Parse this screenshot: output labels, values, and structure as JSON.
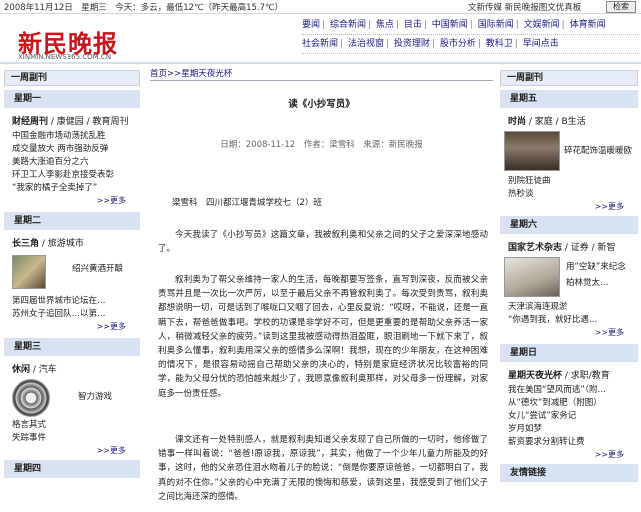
{
  "topbar": {
    "date": "2008年11月12日　星期三　今天：多云，最低12℃（昨天最高15.7℃）",
    "headlines": "文新传媒  新民晚报图文优真板",
    "search_label": "检索"
  },
  "logo": {
    "text": "新民晚报",
    "url": "XINMIN.NEWS365.COM.CN"
  },
  "nav": {
    "row1": [
      "要闻",
      "综合新闻",
      "焦点",
      "目击",
      "中国新闻",
      "国际新闻",
      "文娱新闻",
      "体育新闻"
    ],
    "row2": [
      "社会新闻",
      "法治视窗",
      "投资理财",
      "股市分析",
      "教科卫",
      "早间点击"
    ]
  },
  "left": {
    "title": "一周副刊",
    "sections": [
      {
        "head": "星期一",
        "sub_bold": "财经周刊",
        "sub_rest": " / 康健园 / 教育周刊",
        "items": [
          "中国金融市场动荡扰乱胜",
          "成交量放大 两市强劲反弹",
          "美路大涨逾百分之六",
          "环卫工人李影赴京接受表彰",
          "“我家的橘子全卖掉了”"
        ],
        "more": ">>更多"
      },
      {
        "head": "星期二",
        "sub_bold": "长三角",
        "sub_rest": " / 旅游城市",
        "items": [
          "绍兴黄酒开酿",
          "第四届世界城市论坛在…",
          "苏州女子追回队…以第…"
        ],
        "more": ">>更多"
      },
      {
        "head": "星期三",
        "sub_bold": "休闲",
        "sub_rest": " / 汽车",
        "items": [
          "智力游戏",
          "格言其式",
          "失踪事件"
        ],
        "more": ">>更多"
      },
      {
        "head": "星期四"
      }
    ]
  },
  "article": {
    "breadcrumb": "首页>>星期天夜光杯",
    "title": "读《小抄写员》",
    "meta": "日期：2008-11-12　作者：梁雪科　来源：新民晚报",
    "author_line": "梁雪科　四川都江堰青城学校七（2）班",
    "paragraphs": [
      "今天我读了《小抄写员》这篇文章，我被叙利奥和父亲之间的父子之爱深深地感动了。",
      "叙利奥为了帮父亲维持一家人的生活，每晚都要写签条，直写到深夜，反而被父亲责骂并且是一次比一次严厉，以至于最后父亲不再管叙利奥了。每次受到责骂，叙利奥都想说明一切，可是话到了喉咙口又咽了回去，心里反复说：“哎呀，不能说，还是一直瞒下去，帮爸爸做事吧。学校的功课是非学好不可，但是更重要的是帮助父亲养活一家人，稍微减轻父亲的疲劳。”读到这里我被感动得热泪盈眶，眼泪刷地一下就下来了，叙利奥多么懂事，叙利奥用深父亲的感情多么深啊！我想，现在的少年朋友，在这种困难的情况下，是很容易动摇自己帮助父亲的决心的，特别是家庭经济状况比较富裕的同学，能为父母分忧的恐怕越来越少了，我愿意像叙利奥那样，对父母多一份理解，对家庭多一份责任感。",
      "课文还有一处特别感人，就是叙利奥知道父亲发现了自己所做的一切时，他修做了错事一样叫着说：“爸爸!原谅我，原谅我”，其实，他做了一个少年儿童力所能及的好事，这时，他的父亲恐住泪水吻着儿子的脸说：“倒是你要原谅爸爸，一切都明白了，我真的对不住你。”父亲的心中充满了无限的懊悔和慈爱，读到这里，我感受到了他们父子之间比海还深的感情。"
    ]
  },
  "right": {
    "title": "一周副刊",
    "sections": [
      {
        "head": "星期五",
        "sub_bold": "时尚",
        "sub_rest": " / 家庭 / B生活",
        "items": [
          "碎花配饰温暖暖欧",
          "别院狂徒曲",
          "热秒谈"
        ],
        "more": ">>更多"
      },
      {
        "head": "星期六",
        "sub_bold": "国家艺术杂志",
        "sub_rest": " / 证券 / 新智",
        "items": [
          "用“空缺”来纪念",
          "柏林觉太…",
          "天津滨海连现淤",
          "“你遇到我，就好比遇…"
        ],
        "more": ">>更多"
      },
      {
        "head": "星期日",
        "sub_bold": "星期天夜光杯",
        "sub_rest": " / 求职/教育",
        "items": [
          "我在美国“望风而逃”（附…",
          "从“德坎”到减肥（附图）",
          "女儿“尝试”家务记",
          "岁月如梦",
          "薪资要求分割转让费"
        ],
        "more": ">>更多"
      },
      {
        "head": "友情链接"
      }
    ]
  }
}
